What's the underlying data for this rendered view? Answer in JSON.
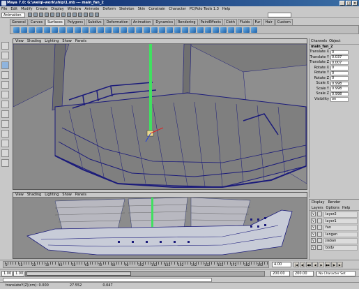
{
  "window": {
    "title": "Maya 7.0: G:\\weiqi-work\\ship\\1.mb  ---  main_fan_2",
    "buttons": [
      "_",
      "□",
      "×"
    ]
  },
  "menubar": {
    "items": [
      "File",
      "Edit",
      "Modify",
      "Create",
      "Display",
      "Window",
      "Animate",
      "Deform",
      "Skeleton",
      "Skin",
      "Constrain",
      "Character",
      "PC/Polo Tools 1.3",
      "Help"
    ]
  },
  "statusline": {
    "mode": "Animation"
  },
  "shelf": {
    "tabs": [
      "General",
      "Curves",
      "Surfaces",
      "Polygons",
      "Subdivs",
      "Deformation",
      "Animation",
      "Dynamics",
      "Rendering",
      "PaintEffects",
      "Cloth",
      "Fluids",
      "Fur",
      "Hair",
      "Custom"
    ],
    "active": "Surfaces"
  },
  "viewport_top": {
    "menu": [
      "View",
      "Shading",
      "Lighting",
      "Show",
      "Panels"
    ]
  },
  "viewport_bottom": {
    "menu": [
      "View",
      "Shading",
      "Lighting",
      "Show",
      "Panels"
    ]
  },
  "channel_box": {
    "tabs": [
      "Channels",
      "Object"
    ],
    "object": "main_fan_2",
    "attributes": [
      {
        "name": "Translate X",
        "value": "0"
      },
      {
        "name": "Translate Y",
        "value": "0.037"
      },
      {
        "name": "Translate Z",
        "value": "0.007"
      },
      {
        "name": "Rotate X",
        "value": "0"
      },
      {
        "name": "Rotate Y",
        "value": "0"
      },
      {
        "name": "Rotate Z",
        "value": "0"
      },
      {
        "name": "Scale X",
        "value": "0.998"
      },
      {
        "name": "Scale Y",
        "value": "0.998"
      },
      {
        "name": "Scale Z",
        "value": "0.998"
      },
      {
        "name": "Visibility",
        "value": "on"
      }
    ]
  },
  "layer_editor": {
    "radios": [
      "Display",
      "Render"
    ],
    "menu": [
      "Layers",
      "Options",
      "Help"
    ],
    "layers": [
      {
        "name": "layer2",
        "visible": "V"
      },
      {
        "name": "layer1",
        "visible": "V"
      },
      {
        "name": "fan",
        "visible": "V"
      },
      {
        "name": "langan",
        "visible": "V"
      },
      {
        "name": "jiaban",
        "visible": "V"
      },
      {
        "name": "body",
        "visible": "V"
      }
    ]
  },
  "time_slider": {
    "ticks": [
      "2",
      "4",
      "6",
      "8",
      "10",
      "12",
      "14",
      "16",
      "18",
      "20",
      "22",
      "24",
      "26",
      "28",
      "30",
      "32",
      "34",
      "36",
      "38",
      "40",
      "42",
      "44",
      "46",
      "48",
      "50",
      "52",
      "54",
      "56",
      "58",
      "60",
      "62",
      "64",
      "66",
      "68",
      "70",
      "72",
      "74",
      "76",
      "78",
      "80",
      "82",
      "84",
      "86",
      "88",
      "90",
      "92",
      "94",
      "96",
      "98",
      "100",
      "102",
      "104",
      "106",
      "108",
      "110",
      "112",
      "114",
      "116",
      "118",
      "120",
      "122",
      "124",
      "126",
      "128",
      "130",
      "132",
      "134",
      "136",
      "138",
      "140",
      "142",
      "144",
      "146",
      "148",
      "150",
      "152",
      "154",
      "156",
      "158",
      "160",
      "162",
      "164",
      "166",
      "168",
      "170",
      "172",
      "174",
      "176",
      "178",
      "180",
      "182",
      "184",
      "186",
      "188",
      "190",
      "192",
      "194",
      "196",
      "198",
      "200"
    ],
    "current_frame": "4.00"
  },
  "range_slider": {
    "start": "1.00",
    "inner_start": "1.00",
    "end": "200.00",
    "inner_end": "200.00",
    "character_set": "No Character Set"
  },
  "help_line": {
    "field1": "translateY(Z)(cm): 0.000",
    "field2": "27.552",
    "field3": "0.047"
  }
}
